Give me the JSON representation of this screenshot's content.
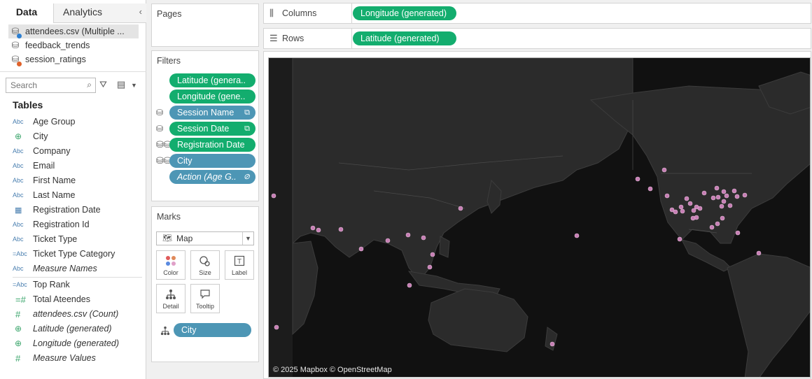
{
  "data_pane": {
    "tabs": {
      "data": "Data",
      "analytics": "Analytics"
    },
    "data_sources": [
      {
        "name": "attendees.csv (Multiple ...",
        "badge_color": "#2c7fd1"
      },
      {
        "name": "feedback_trends",
        "badge_color": ""
      },
      {
        "name": "session_ratings",
        "badge_color": "#e0622a"
      }
    ],
    "search_placeholder": "Search",
    "tables_heading": "Tables",
    "fields": [
      {
        "type": "Abc",
        "name": "Age Group"
      },
      {
        "type": "globe",
        "name": "City"
      },
      {
        "type": "Abc",
        "name": "Company"
      },
      {
        "type": "Abc",
        "name": "Email"
      },
      {
        "type": "Abc",
        "name": "First Name"
      },
      {
        "type": "Abc",
        "name": "Last Name"
      },
      {
        "type": "calendar",
        "name": "Registration Date"
      },
      {
        "type": "Abc",
        "name": "Registration Id"
      },
      {
        "type": "Abc",
        "name": "Ticket Type"
      },
      {
        "type": "=Abc",
        "name": "Ticket Type Category"
      },
      {
        "type": "Abc",
        "name": "Measure Names"
      }
    ],
    "calculated_fields": [
      {
        "type": "=Abc",
        "name": "Top Rank"
      },
      {
        "type": "=#",
        "name": "Total Ateendes"
      },
      {
        "type": "#",
        "name": "attendees.csv (Count)"
      },
      {
        "type": "globe",
        "name": "Latitude (generated)"
      },
      {
        "type": "globe",
        "name": "Longitude (generated)"
      },
      {
        "type": "#",
        "name": "Measure Values"
      }
    ]
  },
  "pages": {
    "title": "Pages"
  },
  "filters": {
    "title": "Filters",
    "pills": [
      {
        "label": "Latitude (genera..",
        "color": "green"
      },
      {
        "label": "Longitude (gene..",
        "color": "green"
      },
      {
        "label": "Session Name",
        "color": "blue"
      },
      {
        "label": "Session Date",
        "color": "green"
      },
      {
        "label": "Registration Date",
        "color": "green"
      },
      {
        "label": "City",
        "color": "blue"
      },
      {
        "label": "Action (Age G..",
        "color": "blue"
      }
    ]
  },
  "marks": {
    "title": "Marks",
    "mark_type": "Map",
    "buttons": {
      "color": "Color",
      "size": "Size",
      "label": "Label",
      "detail": "Detail",
      "tooltip": "Tooltip"
    },
    "detail_pill": "City"
  },
  "shelves": {
    "columns_label": "Columns",
    "columns_pill": "Longitude (generated)",
    "rows_label": "Rows",
    "rows_pill": "Latitude (generated)"
  },
  "map": {
    "copyright": "© 2025 Mapbox © OpenStreetMap",
    "dot_color": "#c77fb5",
    "land_color": "#2b2b2b",
    "sea_color": "#111111"
  }
}
